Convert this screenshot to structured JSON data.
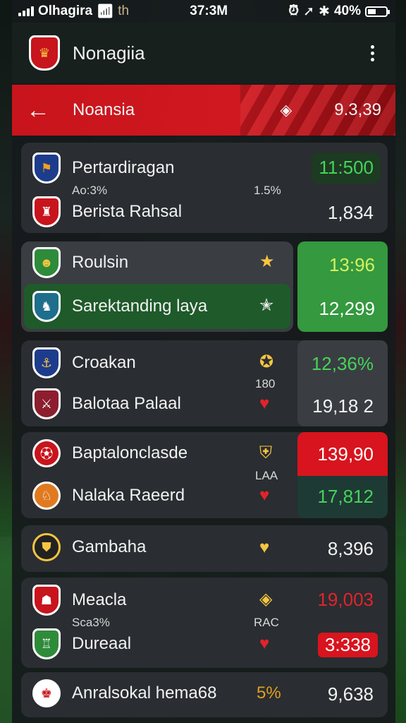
{
  "status": {
    "carrier": "Olhagira",
    "net": "th",
    "time": "37:3M",
    "battery": "40%"
  },
  "header": {
    "title": "Nonagiia"
  },
  "subheader": {
    "title": "Noansia",
    "tag": "◈",
    "value": "9.3,39"
  },
  "cards": [
    {
      "team1": "Pertardiragan",
      "sub": "Ao:3%",
      "mid": "1.5%",
      "team2": "Berista Rahsal",
      "val1": "11:500",
      "val2": "1,834"
    },
    {
      "team1": "Roulsin",
      "team2": "Sarektanding laya",
      "val1": "13:96",
      "val2": "12,299"
    },
    {
      "team1": "Croakan",
      "mid": "180",
      "team2": "Balotaa Palaal",
      "val1": "12,36%",
      "val2": "19,18 2"
    },
    {
      "team1": "Baptalonclasde",
      "mid": "LAA",
      "team2": "Nalaka Raeerd",
      "val1": "139,90",
      "val2": "17,812"
    },
    {
      "team1": "Gambaha",
      "val1": "8,396"
    },
    {
      "team1": "Meacla",
      "sub": "Sca3%",
      "mid": "RAC",
      "team2": "Dureaal",
      "val1": "19,003",
      "val2": "3:338"
    },
    {
      "team1": "Anralsokal hema68",
      "badge": "5%",
      "val1": "9,638"
    }
  ],
  "colors": {
    "accent": "#d01820",
    "green": "#2e8b3a",
    "positive": "#46d35a"
  }
}
